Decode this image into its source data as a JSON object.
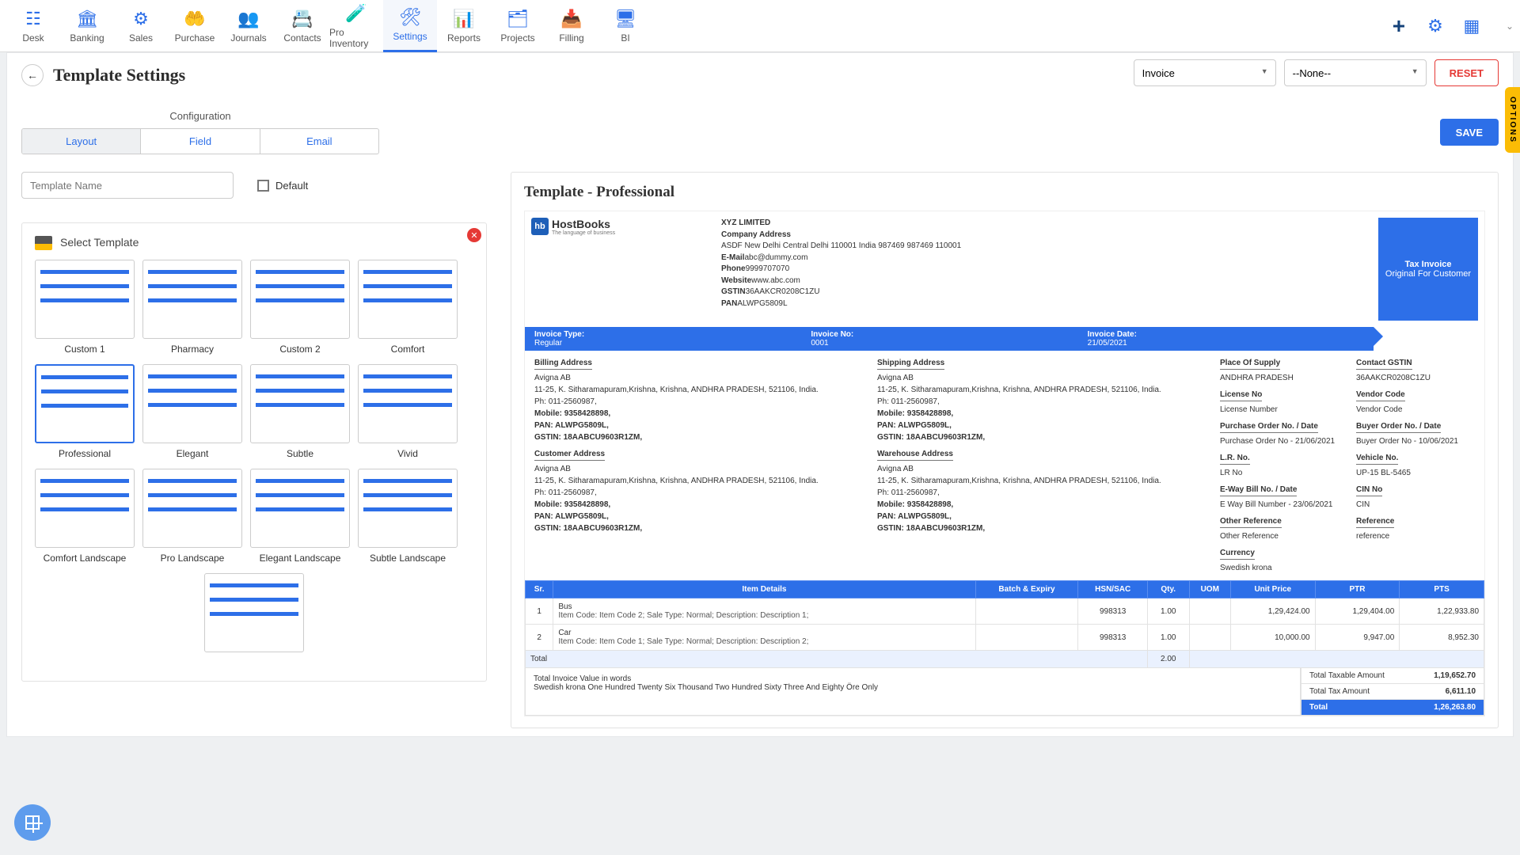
{
  "topnav": [
    "Desk",
    "Banking",
    "Sales",
    "Purchase",
    "Journals",
    "Contacts",
    "Pro Inventory",
    "Settings",
    "Reports",
    "Projects",
    "Filling",
    "BI"
  ],
  "topnav_active": 7,
  "page_title": "Template Settings",
  "dropdown1": "Invoice",
  "dropdown2": "--None--",
  "reset": "RESET",
  "conf_title": "Configuration",
  "conf_tabs": [
    "Layout",
    "Field",
    "Email"
  ],
  "save": "SAVE",
  "tname_ph": "Template Name",
  "default_lbl": "Default",
  "select_tpl": "Select Template",
  "templates": [
    "Custom 1",
    "Pharmacy",
    "Custom 2",
    "Comfort",
    "Professional",
    "Elegant",
    "Subtle",
    "Vivid",
    "Comfort Landscape",
    "Pro Landscape",
    "Elegant Landscape",
    "Subtle Landscape",
    ""
  ],
  "template_sel": 4,
  "preview_title": "Template - Professional",
  "logo_brand": "HostBooks",
  "logo_tag": "The language of business",
  "company": {
    "name": "XYZ LIMITED",
    "addr_lbl": "Company Address",
    "addr": "ASDF New Delhi Central Delhi 110001 India 987469 987469 110001",
    "email_lbl": "E-Mail",
    "email": "abc@dummy.com",
    "phone_lbl": "Phone",
    "phone": "9999707070",
    "web_lbl": "Website",
    "web": "www.abc.com",
    "gstin_lbl": "GSTIN",
    "gstin": "36AAKCR0208C1ZU",
    "pan_lbl": "PAN",
    "pan": "ALWPG5809L"
  },
  "taxbox": {
    "l1": "Tax Invoice",
    "l2": "Original For Customer"
  },
  "banner": {
    "c1": "Invoice Type:",
    "c1v": "Regular",
    "c2": "Invoice No:",
    "c2v": "0001",
    "c3": "Invoice Date:",
    "c3v": "21/05/2021"
  },
  "addr": {
    "billing_h": "Billing Address",
    "shipping_h": "Shipping Address",
    "cust_h": "Customer Address",
    "wh_h": "Warehouse Address",
    "name": "Avigna AB",
    "line": "11-25, K. Sitharamapuram,Krishna, Krishna, ANDHRA PRADESH, 521106, India.",
    "ph": "Ph: 011-2560987,",
    "mob": "Mobile: 9358428898,",
    "pan": "PAN: ALWPG5809L,",
    "gst": "GSTIN: 18AABCU9603R1ZM,"
  },
  "meta": {
    "pos_h": "Place Of Supply",
    "pos": "ANDHRA PRADESH",
    "lic_h": "License No",
    "lic": "License Number",
    "po_h": "Purchase Order No. / Date",
    "po": "Purchase Order No - 21/06/2021",
    "lr_h": "L.R. No.",
    "lr": "LR No",
    "ew_h": "E-Way Bill No. / Date",
    "ew": "E Way Bill Number - 23/06/2021",
    "or_h": "Other Reference",
    "or": "Other Reference",
    "cur_h": "Currency",
    "cur": "Swedish krona",
    "cg_h": "Contact GSTIN",
    "cg": "36AAKCR0208C1ZU",
    "vc_h": "Vendor Code",
    "vc": "Vendor Code",
    "bo_h": "Buyer Order No. / Date",
    "bo": "Buyer Order No - 10/06/2021",
    "vn_h": "Vehicle No.",
    "vn": "UP-15 BL-5465",
    "cin_h": "CIN No",
    "cin": "CIN",
    "ref_h": "Reference",
    "ref": "reference"
  },
  "cols": [
    "Sr.",
    "Item Details",
    "Batch & Expiry",
    "HSN/SAC",
    "Qty.",
    "UOM",
    "Unit Price",
    "PTR",
    "PTS"
  ],
  "rows": [
    {
      "sr": "1",
      "name": "Bus",
      "det": "Item Code: Item Code 2; Sale Type: Normal; Description: Description 1;",
      "hsn": "998313",
      "qty": "1.00",
      "up": "1,29,424.00",
      "ptr": "1,29,404.00",
      "pts": "1,22,933.80"
    },
    {
      "sr": "2",
      "name": "Car",
      "det": "Item Code: Item Code 1; Sale Type: Normal; Description: Description 2;",
      "hsn": "998313",
      "qty": "1.00",
      "up": "10,000.00",
      "ptr": "9,947.00",
      "pts": "8,952.30"
    }
  ],
  "total_lbl": "Total",
  "total_qty": "2.00",
  "words_h": "Total Invoice Value in words",
  "words": "Swedish krona One Hundred Twenty Six Thousand Two Hundred Sixty Three And Eighty Öre Only",
  "sum1": "Total Taxable Amount",
  "sum1v": "1,19,652.70",
  "sum2": "Total Tax Amount",
  "sum2v": "6,611.10",
  "sum3": "Total",
  "sum3v": "1,26,263.80",
  "options": "OPTIONS"
}
